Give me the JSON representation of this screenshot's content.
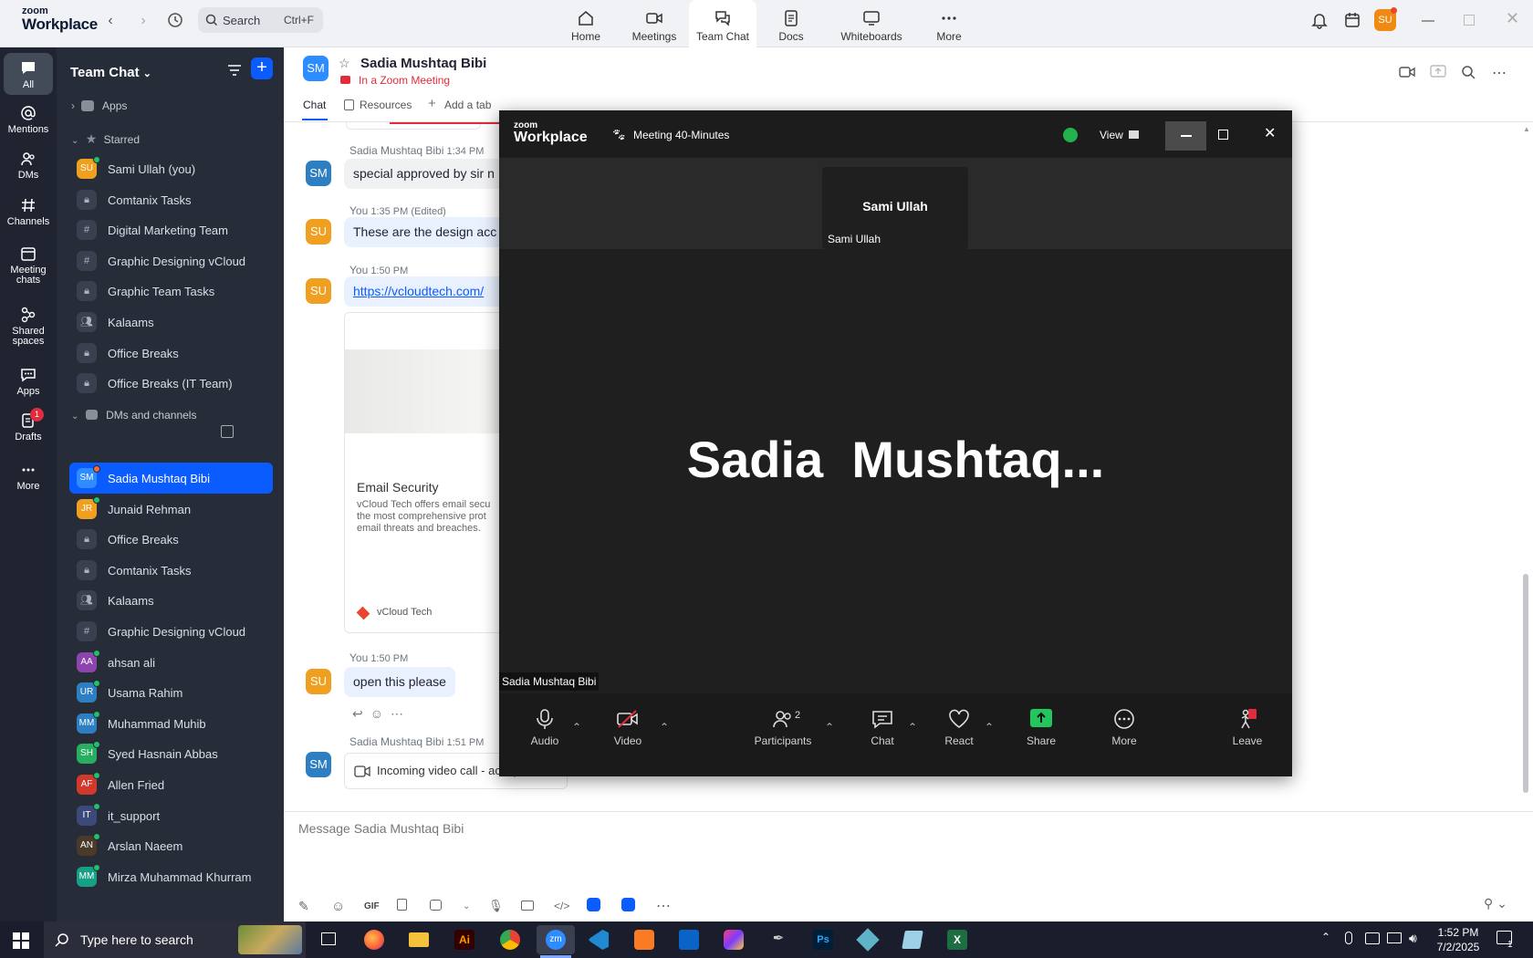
{
  "app": {
    "logo_top": "zoom",
    "logo_bottom": "Workplace"
  },
  "search": {
    "label": "Search",
    "shortcut": "Ctrl+F"
  },
  "nav_tabs": [
    {
      "label": "Home",
      "icon": "home-icon"
    },
    {
      "label": "Meetings",
      "icon": "video-camera-icon"
    },
    {
      "label": "Team Chat",
      "icon": "chat-bubbles-icon"
    },
    {
      "label": "Docs",
      "icon": "document-icon"
    },
    {
      "label": "Whiteboards",
      "icon": "whiteboard-icon"
    },
    {
      "label": "More",
      "icon": "more-dots-icon"
    }
  ],
  "user_avatar": "SU",
  "rail": [
    {
      "label": "All",
      "icon": "chat-icon"
    },
    {
      "label": "Mentions",
      "icon": "at-icon"
    },
    {
      "label": "DMs",
      "icon": "people-icon"
    },
    {
      "label": "Channels",
      "icon": "hash-icon"
    },
    {
      "label": "Meeting",
      "label2": "chats",
      "icon": "calendar-icon"
    },
    {
      "label": "Shared",
      "label2": "spaces",
      "icon": "shared-spaces-icon"
    },
    {
      "label": "Apps",
      "icon": "apps-icon"
    },
    {
      "label": "Drafts",
      "icon": "draft-icon",
      "badge": "1"
    },
    {
      "label": "More",
      "icon": "more-dots-icon"
    }
  ],
  "sidebar": {
    "title": "Team Chat",
    "apps_label": "Apps",
    "starred_label": "Starred",
    "dms_label": "DMs and channels",
    "starred": [
      {
        "label": "Sami Ullah (you)",
        "avatar": "SU",
        "color": "#f0a020",
        "type": "user"
      },
      {
        "label": "Comtanix Tasks",
        "type": "lock"
      },
      {
        "label": "Digital Marketing Team",
        "type": "hash"
      },
      {
        "label": "Graphic Designing vCloud",
        "type": "hash"
      },
      {
        "label": "Graphic Team Tasks",
        "type": "lock"
      },
      {
        "label": "Kalaams",
        "type": "group"
      },
      {
        "label": "Office Breaks",
        "type": "lock"
      },
      {
        "label": "Office Breaks (IT Team)",
        "type": "lock"
      }
    ],
    "dms": [
      {
        "label": "Sadia Mushtaq Bibi",
        "avatar": "SM",
        "color": "#2d8cff",
        "type": "user",
        "selected": true
      },
      {
        "label": "Junaid Rehman",
        "avatar": "JR",
        "color": "#f0a020",
        "type": "user"
      },
      {
        "label": "Office Breaks",
        "type": "lock"
      },
      {
        "label": "Comtanix Tasks",
        "type": "lock"
      },
      {
        "label": "Kalaams",
        "type": "group"
      },
      {
        "label": "Graphic Designing vCloud",
        "type": "hash"
      },
      {
        "label": "ahsan ali",
        "avatar": "AA",
        "color": "#8e44ad",
        "type": "user"
      },
      {
        "label": "Usama Rahim",
        "avatar": "UR",
        "color": "#2d7fc1",
        "type": "user"
      },
      {
        "label": "Muhammad Muhib",
        "avatar": "MM",
        "color": "#2d7fc1",
        "type": "user"
      },
      {
        "label": "Syed Hasnain Abbas",
        "avatar": "SH",
        "color": "#27ae60",
        "type": "user"
      },
      {
        "label": "Allen Fried",
        "avatar": "AF",
        "color": "#d0392b",
        "type": "user"
      },
      {
        "label": "it_support",
        "avatar": "IT",
        "color": "#3b4a7a",
        "type": "user"
      },
      {
        "label": "Arslan Naeem",
        "avatar": "AN",
        "color": "#4a3a2a",
        "type": "user"
      },
      {
        "label": "Mirza Muhammad Khurram",
        "avatar": "MM",
        "color": "#16a085",
        "type": "user"
      }
    ]
  },
  "chat": {
    "contact_name": "Sadia Mushtaq Bibi",
    "contact_avatar": "SM",
    "status": "In a Zoom Meeting",
    "tabs": [
      "Chat",
      "Resources",
      "Add a tab"
    ],
    "messages": [
      {
        "sender": "Sadia Mushtaq Bibi",
        "time": "1:34 PM",
        "text": "special approved by sir n",
        "avatar": "SM"
      },
      {
        "sender": "You",
        "time": "1:35 PM (Edited)",
        "text": "These are the design acc",
        "avatar": "SU"
      },
      {
        "sender": "You",
        "time": "1:50 PM",
        "text": "https://vcloudtech.com/",
        "avatar": "SU"
      },
      {
        "sender": "You",
        "time": "1:50 PM",
        "text": "open this please",
        "avatar": "SU"
      },
      {
        "sender": "Sadia Mushtaq Bibi",
        "time": "1:51 PM",
        "text": "Incoming video call - accepted",
        "avatar": "SM"
      }
    ],
    "link_preview": {
      "title": "Email Security",
      "desc_lines": [
        "vCloud Tech offers email secu",
        "the most comprehensive prot",
        "email threats and breaches."
      ],
      "site": "vCloud Tech"
    },
    "composer_placeholder": "Message Sadia Mushtaq Bibi"
  },
  "meeting": {
    "logo_top": "zoom",
    "logo_bottom": "Workplace",
    "title": "Meeting 40-Minutes",
    "view_label": "View",
    "thumb_name": "Sami Ullah",
    "thumb_caption": "Sami Ullah",
    "main_name": "Sadia  Mushtaq...",
    "main_caption": "Sadia Mushtaq Bibi",
    "toolbar": {
      "audio": "Audio",
      "video": "Video",
      "participants": "Participants",
      "participants_count": "2",
      "chat": "Chat",
      "react": "React",
      "share": "Share",
      "more": "More",
      "leave": "Leave"
    }
  },
  "composer_tools": [
    "GIF"
  ],
  "taskbar": {
    "search_placeholder": "Type here to search",
    "time": "1:52 PM",
    "date": "7/2/2025",
    "notification_count": "1"
  }
}
